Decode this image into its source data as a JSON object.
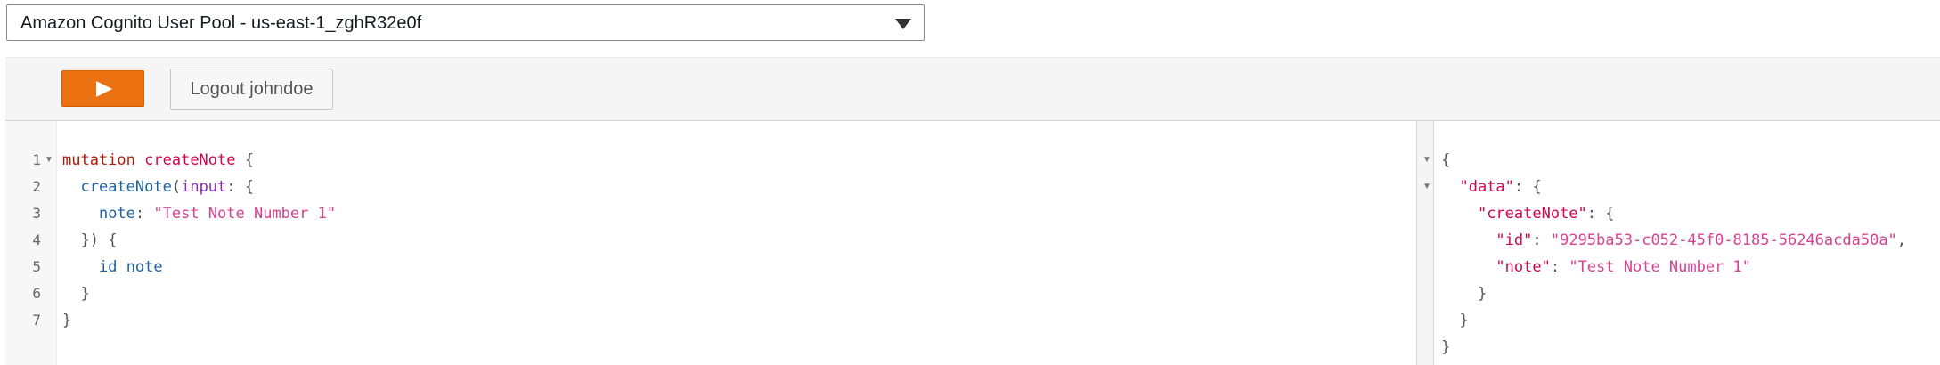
{
  "auth_mode": {
    "selected": "Amazon Cognito User Pool - us-east-1_zghR32e0f"
  },
  "toolbar": {
    "run_icon": "play-icon",
    "logout_label": "Logout johndoe"
  },
  "colors": {
    "run_button": "#ec7211",
    "keyword": "#b11a04",
    "definition": "#d2054e",
    "field": "#1f61a0",
    "argument": "#8b2bb9",
    "string": "#d64292"
  },
  "query_editor": {
    "line_numbers": [
      "1",
      "2",
      "3",
      "4",
      "5",
      "6",
      "7"
    ],
    "lines": {
      "l1_keyword": "mutation",
      "l1_name": "createNote",
      "l1_brace": "{",
      "l2_field": "createNote",
      "l2_paren": "(",
      "l2_arg": "input",
      "l2_rest": ": {",
      "l3_key": "note",
      "l3_colon": ": ",
      "l3_value": "\"Test Note Number 1\"",
      "l4": "}) {",
      "l5_field1": "id",
      "l5_field2": "note",
      "l6": "}",
      "l7": "}"
    }
  },
  "results": {
    "open_brace": "{",
    "data_key": "\"data\"",
    "create_note_key": "\"createNote\"",
    "id_key": "\"id\"",
    "id_value": "\"9295ba53-c052-45f0-8185-56246acda50a\"",
    "note_key": "\"note\"",
    "note_value": "\"Test Note Number 1\"",
    "colon_brace": ": {",
    "colon": ": ",
    "comma": ",",
    "close_brace": "}"
  }
}
